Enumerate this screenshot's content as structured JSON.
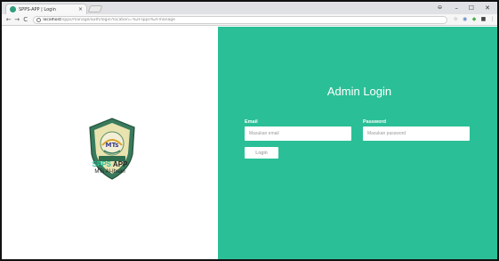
{
  "browser": {
    "tab_title": "SPPS-APP | Login",
    "tab_close": "×",
    "url_host": "localhost",
    "url_path": "/spps/manage/auth/login?location=%2Fspps%2Fmanage",
    "window_controls": {
      "profile": "⊖",
      "minimize": "–",
      "maximize": "☐",
      "close": "✕"
    },
    "nav": {
      "back": "←",
      "forward": "→",
      "reload": "C"
    }
  },
  "left_panel": {
    "app_name_accent": "SPPS",
    "app_name_rest": " APP",
    "school": "MTs Al-Ihsan",
    "logo_text": "MTs"
  },
  "login": {
    "title": "Admin Login",
    "email_label": "Email",
    "email_placeholder": "Masukan email",
    "password_label": "Password",
    "password_placeholder": "Masukan password",
    "button_label": "Login"
  },
  "colors": {
    "accent": "#2bbf97",
    "panel_bg": "#2bbf97",
    "text_white": "#ffffff"
  }
}
